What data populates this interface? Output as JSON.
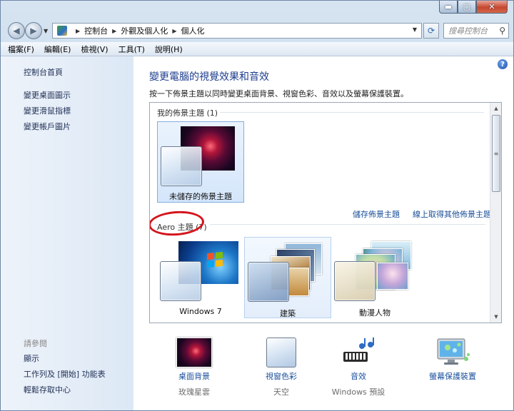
{
  "navigation": {
    "breadcrumbs": [
      "控制台",
      "外觀及個人化",
      "個人化"
    ],
    "search_placeholder": "搜尋控制台"
  },
  "window_buttons": {
    "minimize": "▬",
    "maximize": "▢",
    "close": "✕"
  },
  "menu": [
    "檔案(F)",
    "編輯(E)",
    "檢視(V)",
    "工具(T)",
    "說明(H)"
  ],
  "sidebar": {
    "links": [
      "控制台首頁",
      "變更桌面圖示",
      "變更滑鼠指標",
      "變更帳戶圖片"
    ],
    "see_also_title": "請參閱",
    "see_also": [
      "顯示",
      "工作列及 [開始] 功能表",
      "輕鬆存取中心"
    ]
  },
  "main": {
    "heading": "變更電腦的視覺效果和音效",
    "subtext": "按一下佈景主題以同時變更桌面背景、視窗色彩、音效以及螢幕保護裝置。",
    "my_themes_title": "我的佈景主題 (1)",
    "my_themes": [
      {
        "label": "未儲存的佈景主題",
        "selected": true
      }
    ],
    "save_theme_link": "儲存佈景主題",
    "get_more_link": "線上取得其他佈景主題",
    "aero_title": "Aero 主題 (7)",
    "aero_themes": [
      {
        "label": "Windows 7",
        "selected": false
      },
      {
        "label": "建築",
        "selected": false,
        "hovered": true
      },
      {
        "label": "動漫人物",
        "selected": false
      }
    ]
  },
  "bottom_bar": [
    {
      "label": "桌面背景",
      "value": "玫瑰星雲",
      "icon": "desktop-background-icon"
    },
    {
      "label": "視窗色彩",
      "value": "天空",
      "icon": "window-color-icon"
    },
    {
      "label": "音效",
      "value": "Windows 預設",
      "icon": "sounds-icon"
    },
    {
      "label": "螢幕保護裝置",
      "value": "",
      "icon": "screensaver-icon"
    }
  ],
  "colors": {
    "accent": "#1d3d8f",
    "link": "#1a4f9a",
    "selection": "#d4e6fb",
    "annotation": "#d4131b"
  }
}
